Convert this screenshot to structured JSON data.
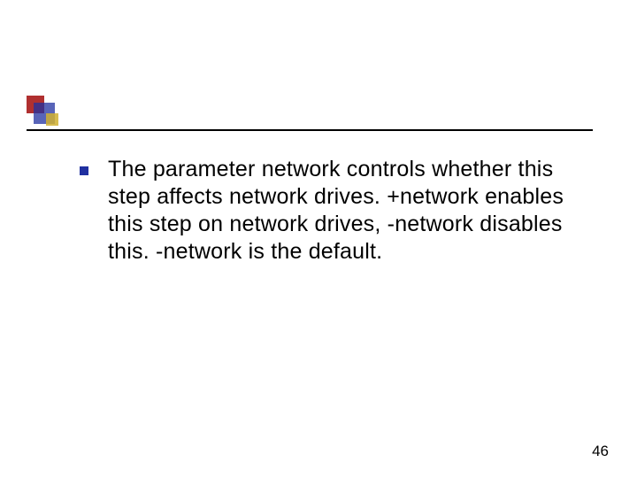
{
  "content": {
    "bullet_text": "The parameter network controls whether this step affects network drives. +network enables this step on network drives, -network disables this. -network is the default."
  },
  "footer": {
    "page_number": "46"
  }
}
